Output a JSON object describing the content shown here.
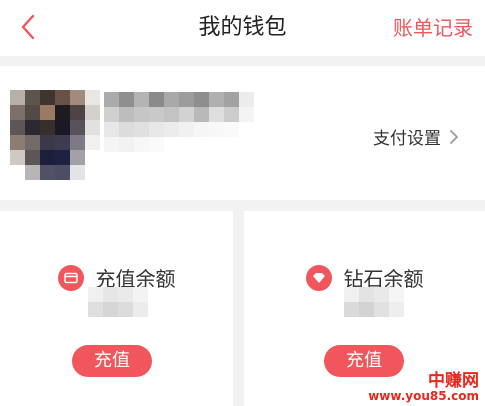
{
  "header": {
    "title": "我的钱包",
    "right_action": "账单记录",
    "back_icon": "chevron-left-icon"
  },
  "profile": {
    "avatar_blurred": true,
    "nickname_blurred": true,
    "pay_settings_label": "支付设置",
    "pay_settings_icon": "chevron-right-icon"
  },
  "balances": [
    {
      "label": "充值余额",
      "icon": "card-icon",
      "value_blurred": true,
      "button_label": "充值"
    },
    {
      "label": "钻石余额",
      "icon": "diamond-icon",
      "value_blurred": true,
      "button_label": "充值"
    }
  ],
  "watermark": {
    "line1": "中赚网",
    "line2": "www.you85.com"
  },
  "colors": {
    "accent": "#f0565b",
    "background": "#f2f2f2",
    "text": "#333333"
  }
}
